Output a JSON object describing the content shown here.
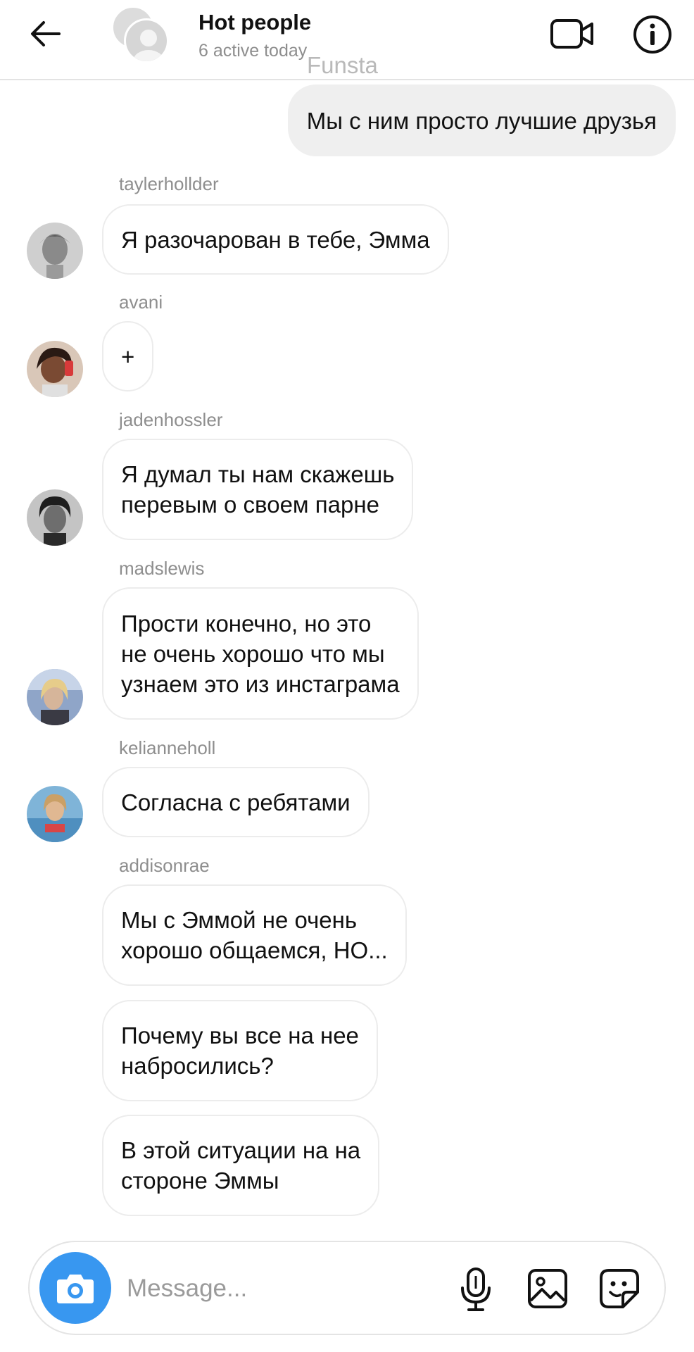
{
  "header": {
    "title": "Hot people",
    "subtitle": "6 active today",
    "watermark": "Funsta",
    "icons": {
      "back": "arrow-left-icon",
      "video": "video-call-icon",
      "info": "info-icon"
    }
  },
  "messages": {
    "outgoing": {
      "text": "Мы с ним просто лучшие друзья"
    },
    "m1": {
      "sender": "taylerhollder",
      "text": "Я разочарован в тебе, Эмма"
    },
    "m2": {
      "sender": "avani",
      "text": "+"
    },
    "m3": {
      "sender": "jadenhossler",
      "text": "Я думал ты нам скажешь\nперевым о своем парне"
    },
    "m4": {
      "sender": "madslewis",
      "text": "Прости конечно, но это\nне очень хорошо что мы\nузнаем это из инстаграма"
    },
    "m5": {
      "sender": "kelianneholl",
      "text": "Согласна с ребятами"
    },
    "m6": {
      "sender": "addisonrae",
      "text": "Мы с Эммой не очень\nхорошо общаемся, НО..."
    },
    "m7": {
      "text": "Почему вы все на нее\nнабросились?"
    },
    "m8": {
      "text": "В этой ситуации на на\nстороне Эммы"
    }
  },
  "composer": {
    "placeholder": "Message...",
    "icons": {
      "camera": "camera-icon",
      "mic": "microphone-icon",
      "gallery": "gallery-icon",
      "sticker": "sticker-icon"
    }
  },
  "colors": {
    "accent": "#3897f0",
    "outgoing_bubble": "#efefef",
    "incoming_border": "#ececec",
    "meta_text": "#8e8e8e"
  }
}
